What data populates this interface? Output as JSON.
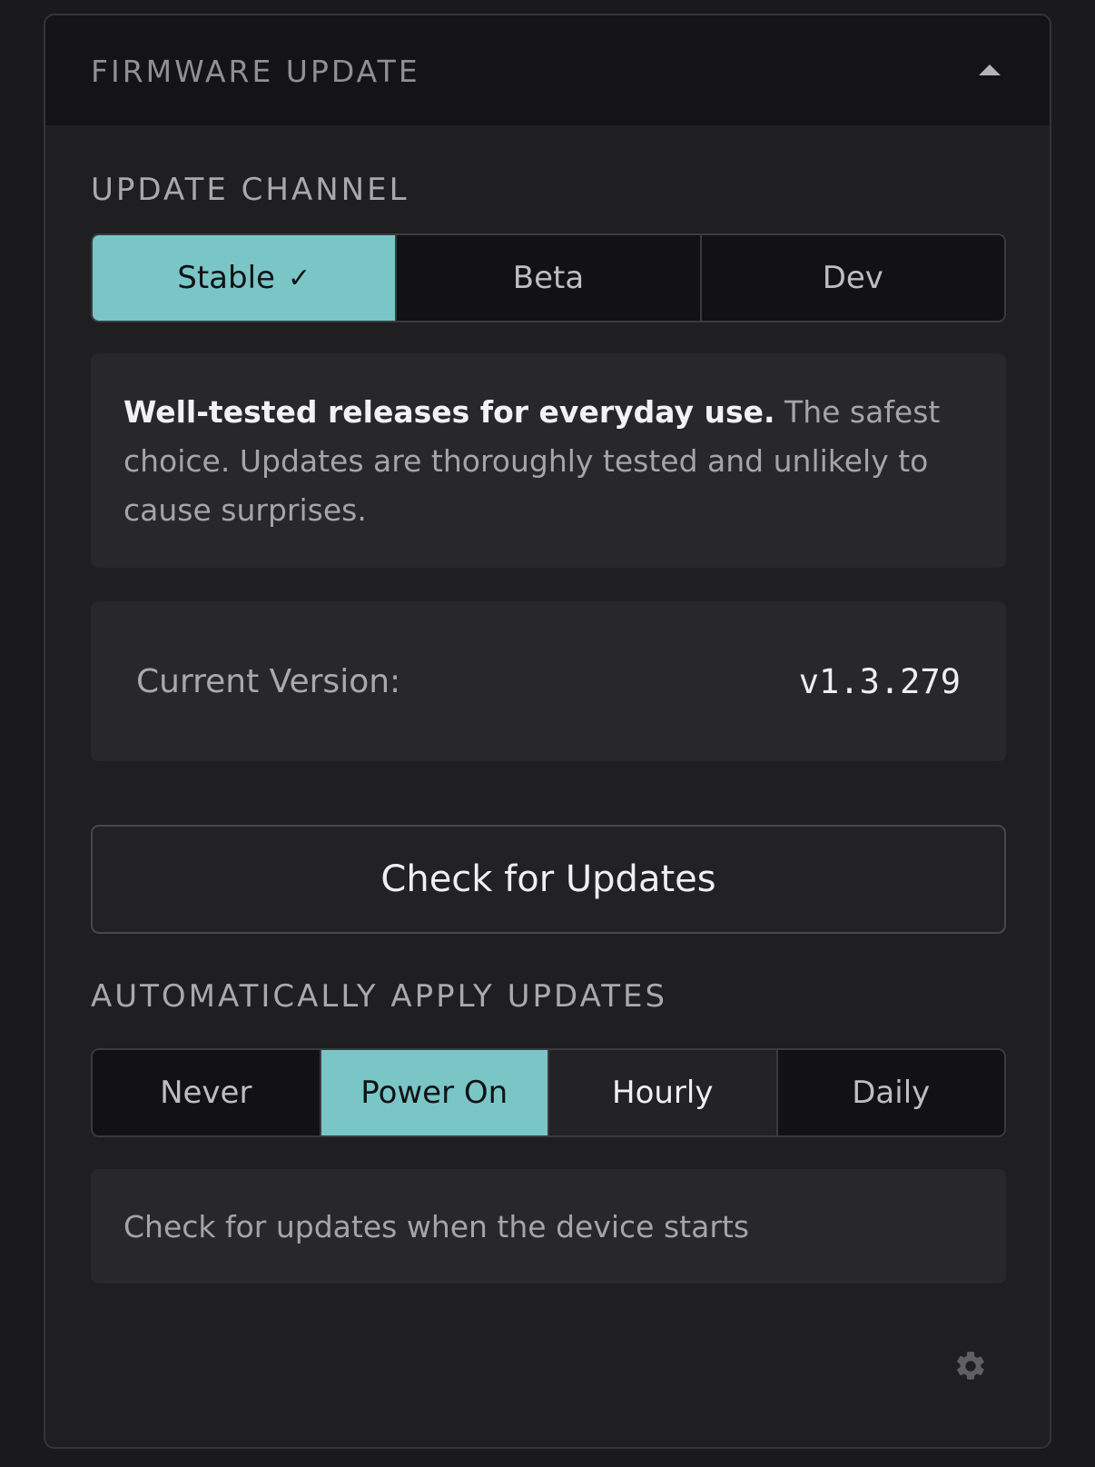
{
  "panel": {
    "title": "FIRMWARE UPDATE",
    "collapse_icon": "caret-up-icon"
  },
  "update_channel": {
    "label": "UPDATE CHANNEL",
    "options": [
      "Stable",
      "Beta",
      "Dev"
    ],
    "selected": "Stable",
    "selected_mark": "✓",
    "description_bold": "Well-tested releases for everyday use.",
    "description_rest": " The safest choice. Updates are thoroughly tested and unlikely to cause surprises."
  },
  "version": {
    "label": "Current Version:",
    "value": "v1.3.279"
  },
  "check_button": {
    "label": "Check for Updates"
  },
  "auto_apply": {
    "label": "AUTOMATICALLY APPLY UPDATES",
    "options": [
      "Never",
      "Power On",
      "Hourly",
      "Daily"
    ],
    "selected": "Power On",
    "hovered": "Hourly",
    "hint": "Check for updates when the device starts"
  },
  "footer": {
    "settings_icon": "gear-icon"
  },
  "colors": {
    "accent": "#7ac6c7",
    "panel_bg": "#1f1f21",
    "header_bg": "#141416"
  }
}
